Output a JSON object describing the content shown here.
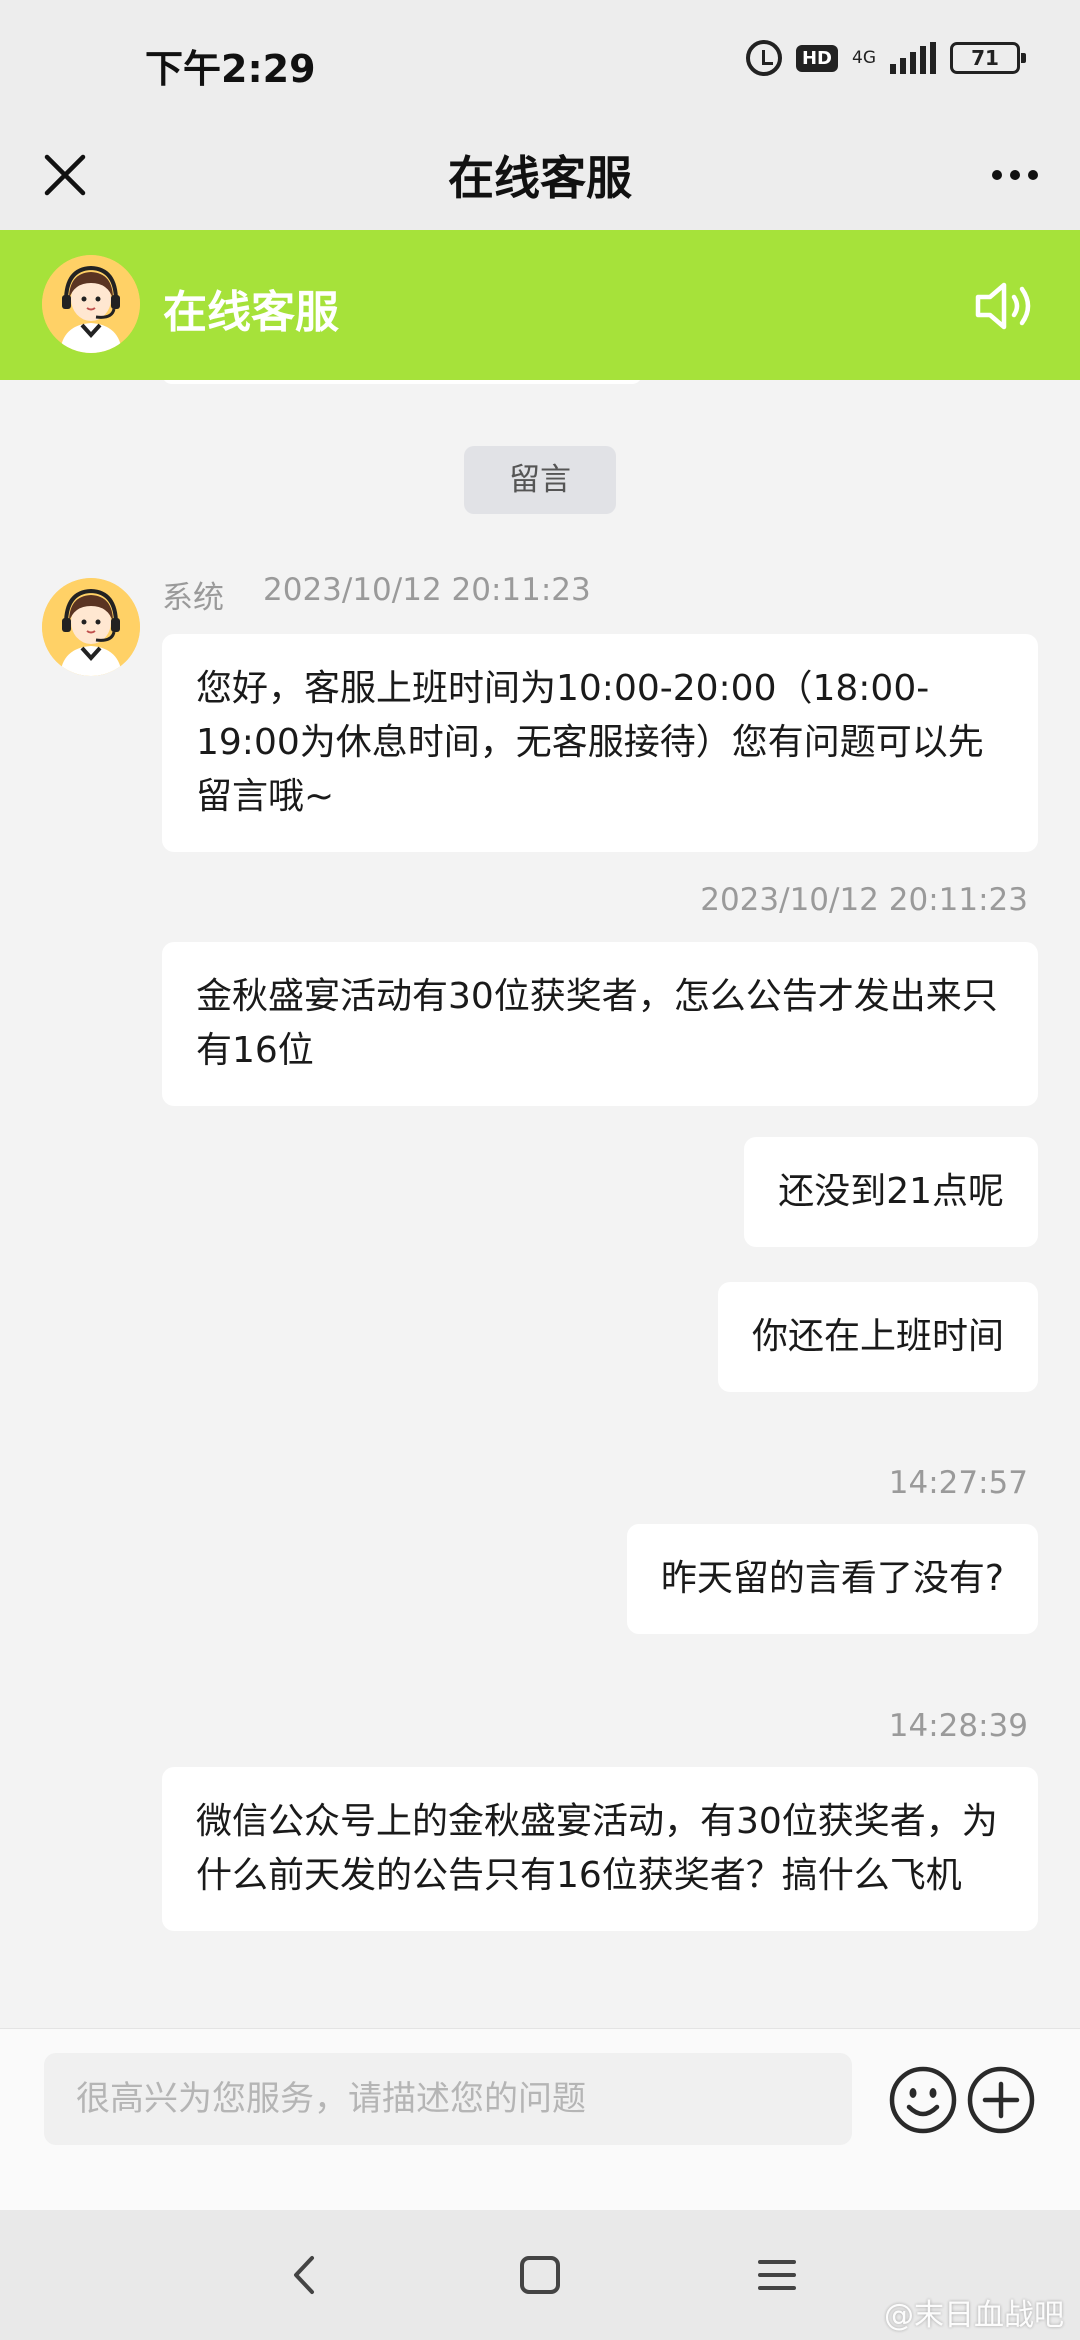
{
  "status_bar": {
    "time": "下午2:29",
    "hd": "HD",
    "network": "4G",
    "battery": "71"
  },
  "title_bar": {
    "title": "在线客服",
    "close_icon": "close-icon",
    "more_icon": "more-icon"
  },
  "agent_bar": {
    "name": "在线客服",
    "background": "#a6e23a",
    "speaker_icon": "speaker-icon"
  },
  "chat": {
    "leave_message_label": "留言",
    "system_sender": "系统",
    "system_time": "2023/10/12 20:11:23",
    "system_message": "您好，客服上班时间为10:00-20:00（18:00-19:00为休息时间，无客服接待）您有问题可以先留言哦~",
    "msg1_time": "2023/10/12 20:11:23",
    "msg1": "金秋盛宴活动有30位获奖者，怎么公告才发出来只有16位",
    "msg2": "还没到21点呢",
    "msg3": "你还在上班时间",
    "msg4_time": "14:27:57",
    "msg4": "昨天留的言看了没有?",
    "msg5_time": "14:28:39",
    "msg5": "微信公众号上的金秋盛宴活动，有30位获奖者，为什么前天发的公告只有16位获奖者？搞什么飞机"
  },
  "input_bar": {
    "placeholder": "很高兴为您服务，请描述您的问题",
    "emoji_icon": "emoji-icon",
    "plus_icon": "plus-icon"
  },
  "nav_bar": {
    "back_icon": "back-icon",
    "home_icon": "home-icon",
    "menu_icon": "menu-icon"
  },
  "watermark": "@末日血战吧"
}
